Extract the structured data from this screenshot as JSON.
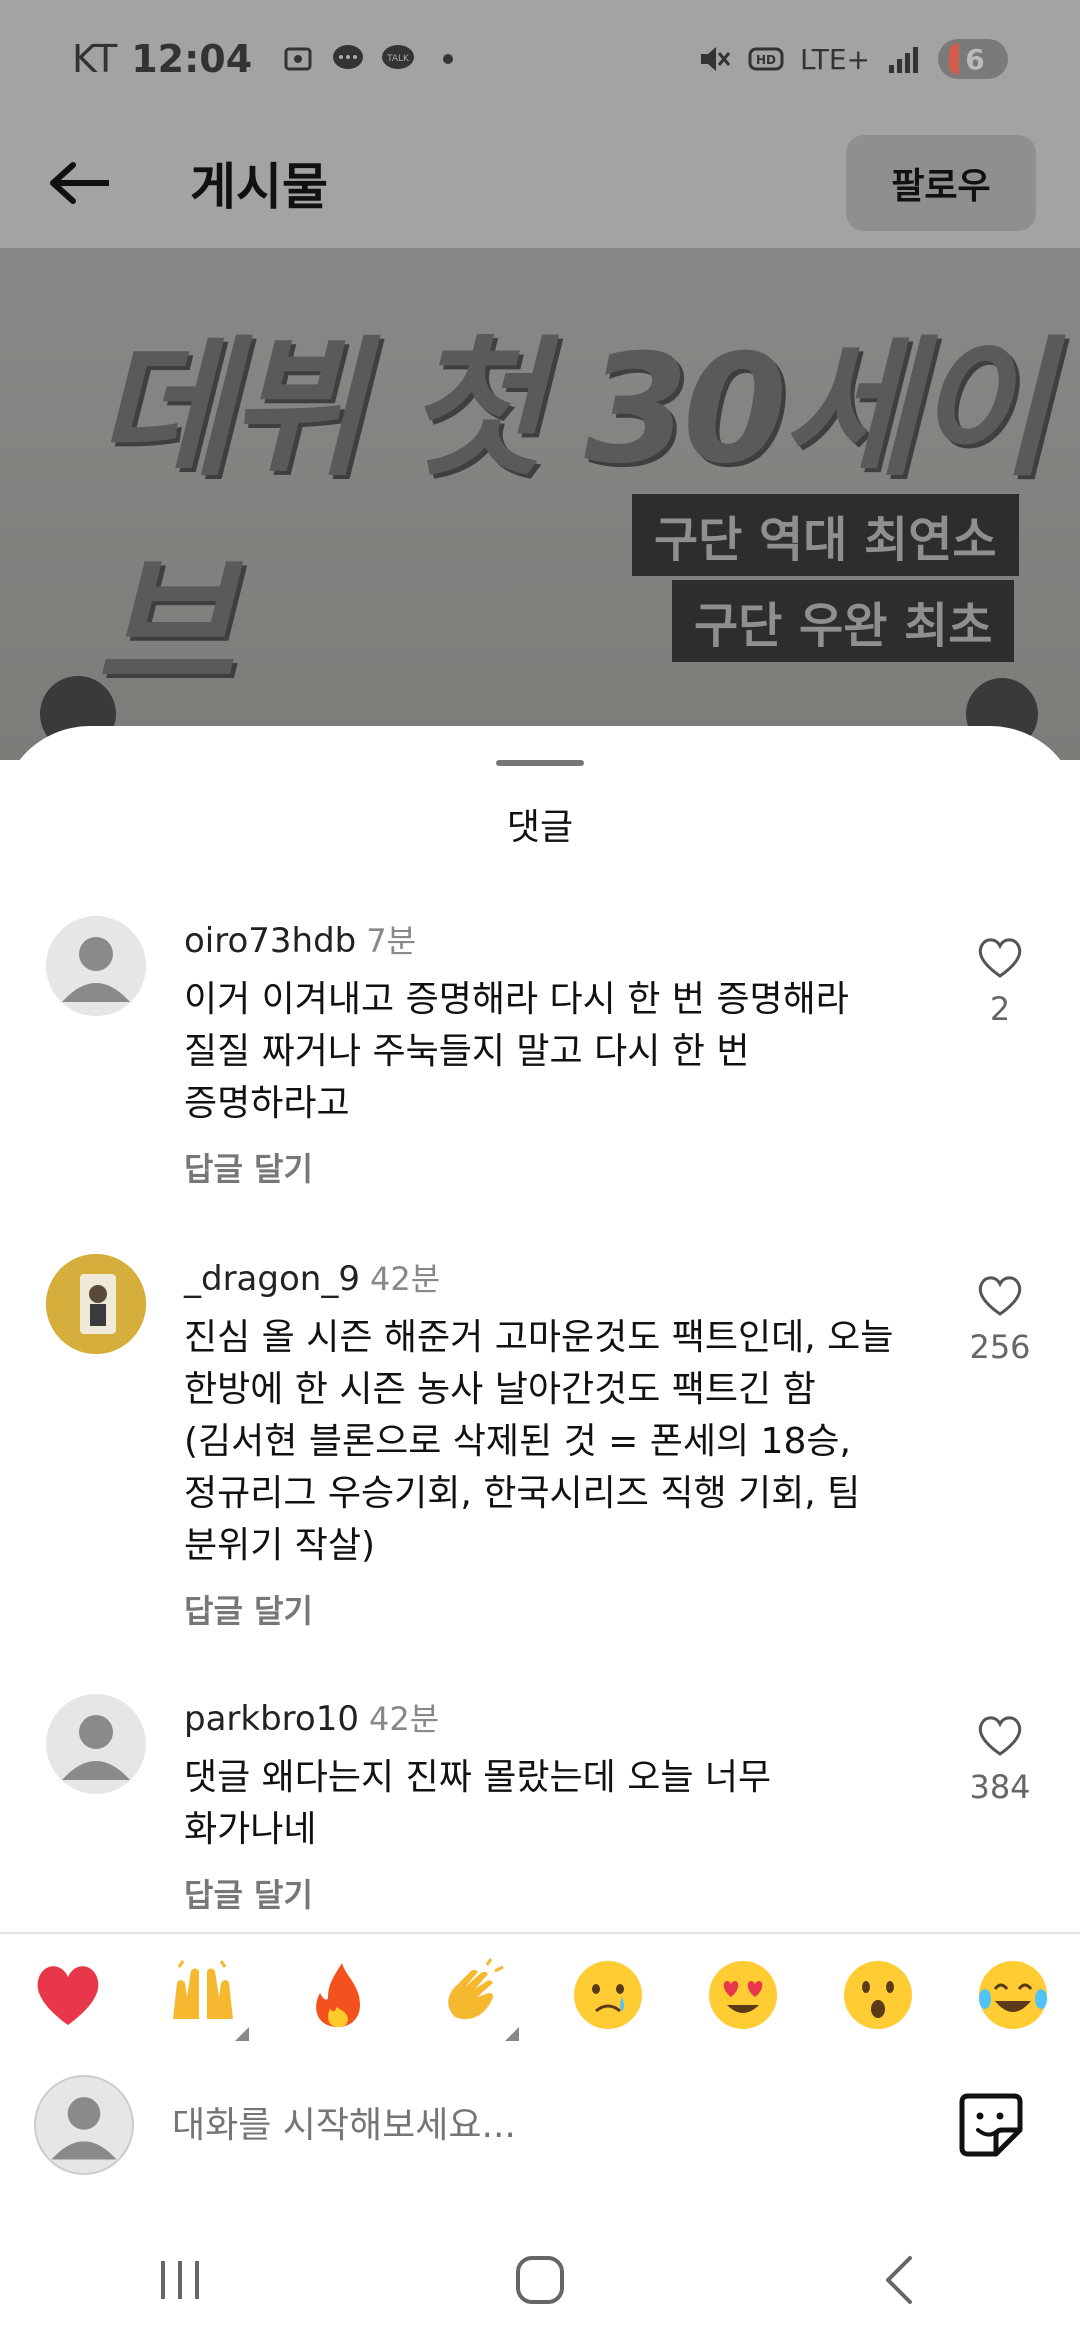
{
  "status_bar": {
    "carrier": "KT",
    "time": "12:04",
    "network": "LTE+",
    "battery": "6"
  },
  "appbar": {
    "title": "게시물",
    "follow_label": "팔로우"
  },
  "post": {
    "headline": "데뷔 첫 30세이브",
    "tag1": "구단 역대 최연소",
    "tag2": "구단 우완 최초"
  },
  "sheet": {
    "title": "댓글"
  },
  "comments": [
    {
      "user": "oiro73hdb",
      "time": "7분",
      "text": "이거 이겨내고 증명해라 다시 한 번 증명해라\n질질 짜거나 주눅들지 말고 다시 한 번\n증명하라고",
      "reply": "답글 달기",
      "likes": "2"
    },
    {
      "user": "_dragon_9",
      "time": "42분",
      "text": "진심 올 시즌 해준거 고마운것도 팩트인데, 오늘\n한방에 한 시즌 농사 날아간것도 팩트긴 함\n(김서현 블론으로 삭제된 것 = 폰세의 18승,\n정규리그 우승기회, 한국시리즈 직행 기회, 팀\n분위기 작살)",
      "reply": "답글 달기",
      "likes": "256"
    },
    {
      "user": "parkbro10",
      "time": "42분",
      "text": "댓글 왜다는지 진짜 몰랐는데 오늘 너무\n화가나네",
      "reply": "답글 달기",
      "likes": "384"
    }
  ],
  "emojis": [
    "red-heart",
    "raising-hands",
    "fire",
    "clapping-hands",
    "crying-face",
    "heart-eyes-face",
    "surprised-face",
    "tears-of-joy-face"
  ],
  "input": {
    "placeholder": "대화를 시작해보세요..."
  },
  "colors": {
    "dim_overlay": "#a3a3a3",
    "sheet_bg": "#ffffff",
    "muted_text": "#888888",
    "heart_red": "#e8364a"
  }
}
